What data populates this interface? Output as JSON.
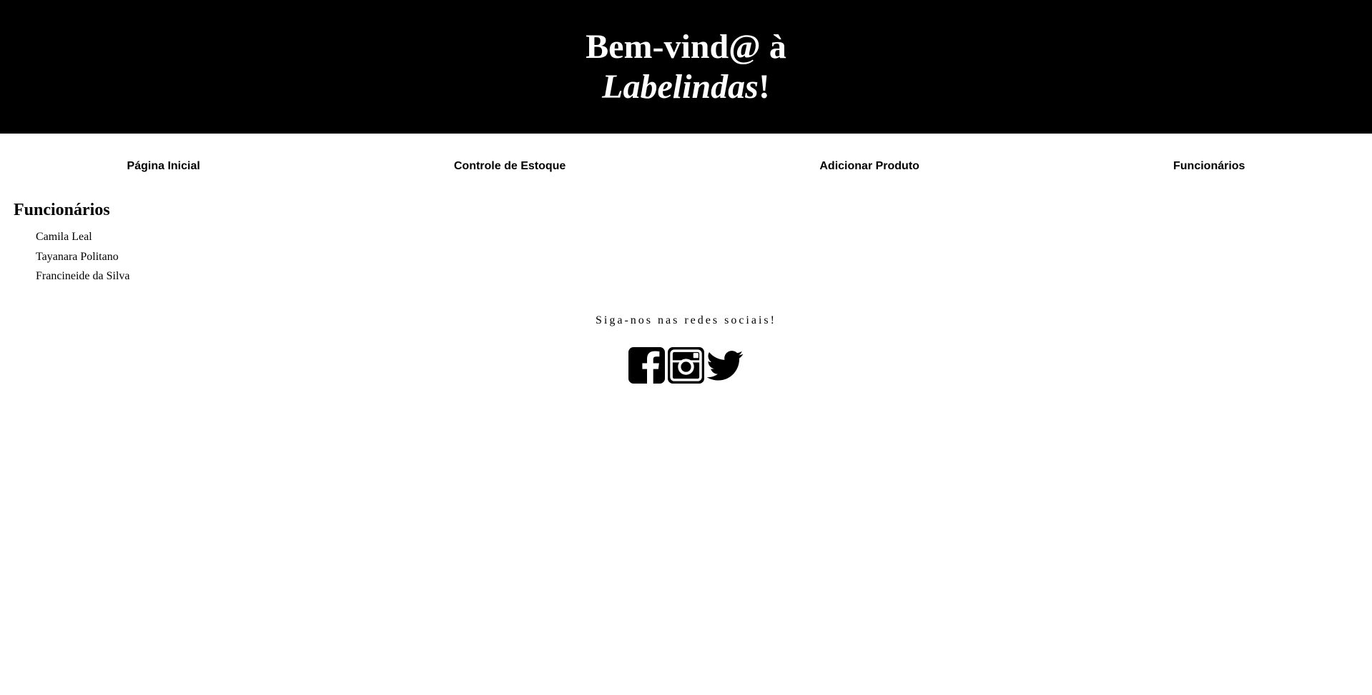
{
  "header": {
    "title_prefix": "Bem-vind@ à",
    "title_brand": "Labelindas",
    "title_suffix": "!"
  },
  "nav": {
    "items": [
      {
        "label": "Página Inicial"
      },
      {
        "label": "Controle de Estoque"
      },
      {
        "label": "Adicionar Produto"
      },
      {
        "label": "Funcionários"
      }
    ]
  },
  "main": {
    "heading": "Funcionários",
    "employees": [
      "Camila Leal",
      "Tayanara Politano",
      "Francineide da Silva"
    ]
  },
  "footer": {
    "follow_text": "Siga-nos nas redes sociais!",
    "icons": [
      "facebook-icon",
      "instagram-icon",
      "twitter-icon"
    ]
  }
}
